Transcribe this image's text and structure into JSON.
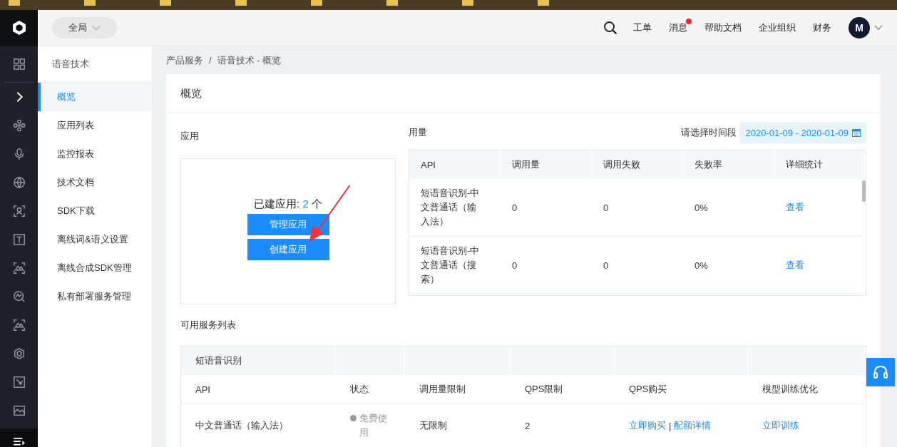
{
  "header": {
    "scope": "全局",
    "nav": [
      {
        "label": "工单",
        "unread": false
      },
      {
        "label": "消息",
        "unread": true
      },
      {
        "label": "帮助文档",
        "unread": false
      },
      {
        "label": "企业组织",
        "unread": false
      },
      {
        "label": "财务",
        "unread": false
      }
    ],
    "avatar": "M"
  },
  "sidebar": {
    "title": "语音技术",
    "items": [
      {
        "label": "概览",
        "selected": true
      },
      {
        "label": "应用列表",
        "selected": false
      },
      {
        "label": "监控报表",
        "selected": false
      },
      {
        "label": "技术文档",
        "selected": false
      },
      {
        "label": "SDK下载",
        "selected": false
      },
      {
        "label": "离线词&语义设置",
        "selected": false
      },
      {
        "label": "离线合成SDK管理",
        "selected": false
      },
      {
        "label": "私有部署服务管理",
        "selected": false
      }
    ]
  },
  "breadcrumb": {
    "items": [
      "产品服务",
      "语音技术 - 概览"
    ],
    "separator": "/"
  },
  "card_title": "概览",
  "apps": {
    "title": "应用",
    "summary_label": "已建应用:",
    "count": "2",
    "unit": "个",
    "buttons": [
      "管理应用",
      "创建应用"
    ]
  },
  "usage": {
    "title": "用量",
    "date_label": "请选择时间段",
    "date_range": "2020-01-09 - 2020-01-09",
    "columns": [
      "API",
      "调用量",
      "调用失败",
      "失败率",
      "详细统计"
    ],
    "rows": [
      {
        "api": "短语音识别-中文普通话（输入法）",
        "calls": "0",
        "failures": "0",
        "failure_rate": "0%",
        "details": "查看"
      },
      {
        "api": "短语音识别-中文普通话（搜索）",
        "calls": "0",
        "failures": "0",
        "failure_rate": "0%",
        "details": "查看"
      }
    ]
  },
  "services": {
    "title": "可用服务列表",
    "group": "短语音识别",
    "columns": [
      "API",
      "状态",
      "调用量限制",
      "QPS限制",
      "QPS购买",
      "模型训练优化"
    ],
    "rows": [
      {
        "api": "中文普通话（输入法）",
        "status": "免费使用",
        "call_limit": "无限制",
        "qps_limit": "2",
        "purchase": [
          "立即购买",
          "配额详情"
        ],
        "purchase_separator": "|",
        "training": "立即训练"
      }
    ]
  }
}
